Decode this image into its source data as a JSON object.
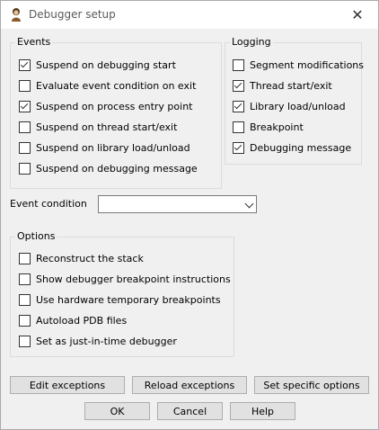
{
  "window": {
    "title": "Debugger setup"
  },
  "events": {
    "label": "Events",
    "items": [
      {
        "label": "Suspend on debugging start",
        "checked": true
      },
      {
        "label": "Evaluate event condition on exit",
        "checked": false
      },
      {
        "label": "Suspend on process entry point",
        "checked": true
      },
      {
        "label": "Suspend on thread start/exit",
        "checked": false
      },
      {
        "label": "Suspend on library load/unload",
        "checked": false
      },
      {
        "label": "Suspend on debugging message",
        "checked": false
      }
    ]
  },
  "logging": {
    "label": "Logging",
    "items": [
      {
        "label": "Segment modifications",
        "checked": false
      },
      {
        "label": "Thread start/exit",
        "checked": true
      },
      {
        "label": "Library load/unload",
        "checked": true
      },
      {
        "label": "Breakpoint",
        "checked": false
      },
      {
        "label": "Debugging message",
        "checked": true
      }
    ]
  },
  "event_condition": {
    "label": "Event condition",
    "value": ""
  },
  "options": {
    "label": "Options",
    "items": [
      {
        "label": "Reconstruct the stack",
        "checked": false
      },
      {
        "label": "Show debugger breakpoint instructions",
        "checked": false
      },
      {
        "label": "Use hardware temporary breakpoints",
        "checked": false
      },
      {
        "label": "Autoload PDB files",
        "checked": false
      },
      {
        "label": "Set as just-in-time debugger",
        "checked": false
      }
    ]
  },
  "buttons": {
    "edit_exceptions": "Edit exceptions",
    "reload_exceptions": "Reload exceptions",
    "set_specific_options": "Set specific options",
    "ok": "OK",
    "cancel": "Cancel",
    "help": "Help"
  }
}
